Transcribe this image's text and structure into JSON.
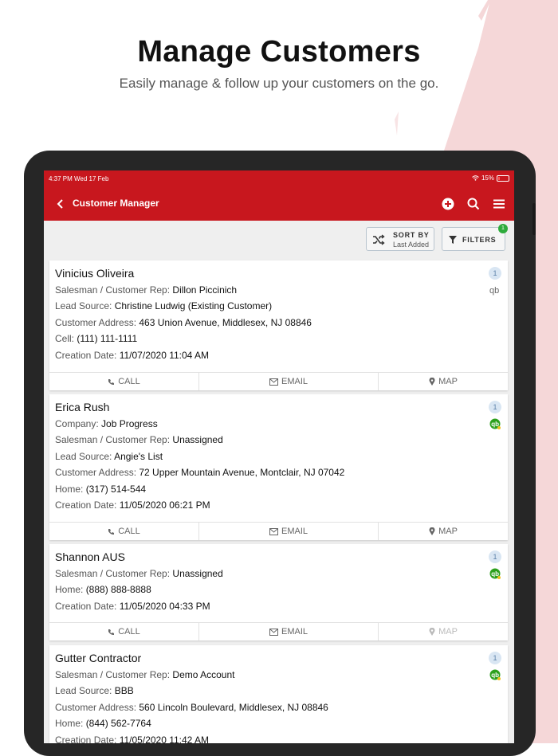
{
  "promo": {
    "title": "Manage Customers",
    "subtitle": "Easily manage & follow up your customers on the go."
  },
  "status_bar": {
    "time_date": "4:37 PM  Wed 17 Feb",
    "battery": "15%"
  },
  "toolbar": {
    "title": "Customer Manager"
  },
  "sort": {
    "label": "SORT BY",
    "value": "Last Added"
  },
  "filters": {
    "label": "FILTERS",
    "badge": "1"
  },
  "actions": {
    "call": "CALL",
    "email": "EMAIL",
    "map": "MAP"
  },
  "customers": [
    {
      "name": "Vinicius Oliveira",
      "count": "1",
      "lines": [
        {
          "label": "Salesman / Customer Rep: ",
          "value": "Dillon Piccinich"
        },
        {
          "label": "Lead Source: ",
          "value": "Christine Ludwig (Existing Customer)"
        },
        {
          "label": "Customer Address: ",
          "value": "463 Union Avenue, Middlesex, NJ 08846"
        },
        {
          "label": "Cell: ",
          "value": "(111) 111-1111"
        },
        {
          "label": "Creation Date: ",
          "value": "11/07/2020 11:04 AM"
        }
      ]
    },
    {
      "name": "Erica Rush",
      "count": "1",
      "lines": [
        {
          "label": "Company: ",
          "value": "Job Progress"
        },
        {
          "label": "Salesman / Customer Rep: ",
          "value": "Unassigned"
        },
        {
          "label": "Lead Source: ",
          "value": "Angie's List"
        },
        {
          "label": "Customer Address: ",
          "value": "72 Upper Mountain Avenue, Montclair, NJ 07042"
        },
        {
          "label": "Home: ",
          "value": "(317) 514-544"
        },
        {
          "label": "Creation Date: ",
          "value": "11/05/2020 06:21 PM"
        }
      ]
    },
    {
      "name": "Shannon AUS",
      "count": "1",
      "lines": [
        {
          "label": "Salesman / Customer Rep: ",
          "value": "Unassigned"
        },
        {
          "label": "Home: ",
          "value": "(888) 888-8888"
        },
        {
          "label": "Creation Date: ",
          "value": "11/05/2020 04:33 PM"
        }
      ]
    },
    {
      "name": "Gutter Contractor",
      "count": "1",
      "lines": [
        {
          "label": "Salesman / Customer Rep: ",
          "value": "Demo Account"
        },
        {
          "label": "Lead Source: ",
          "value": "BBB"
        },
        {
          "label": "Customer Address: ",
          "value": "560 Lincoln Boulevard, Middlesex, NJ 08846"
        },
        {
          "label": "Home: ",
          "value": "(844) 562-7764"
        },
        {
          "label": "Creation Date: ",
          "value": "11/05/2020 11:42 AM"
        }
      ]
    }
  ],
  "colors": {
    "brand_red": "#c8171e",
    "quickbooks_green": "#2ca01c"
  }
}
